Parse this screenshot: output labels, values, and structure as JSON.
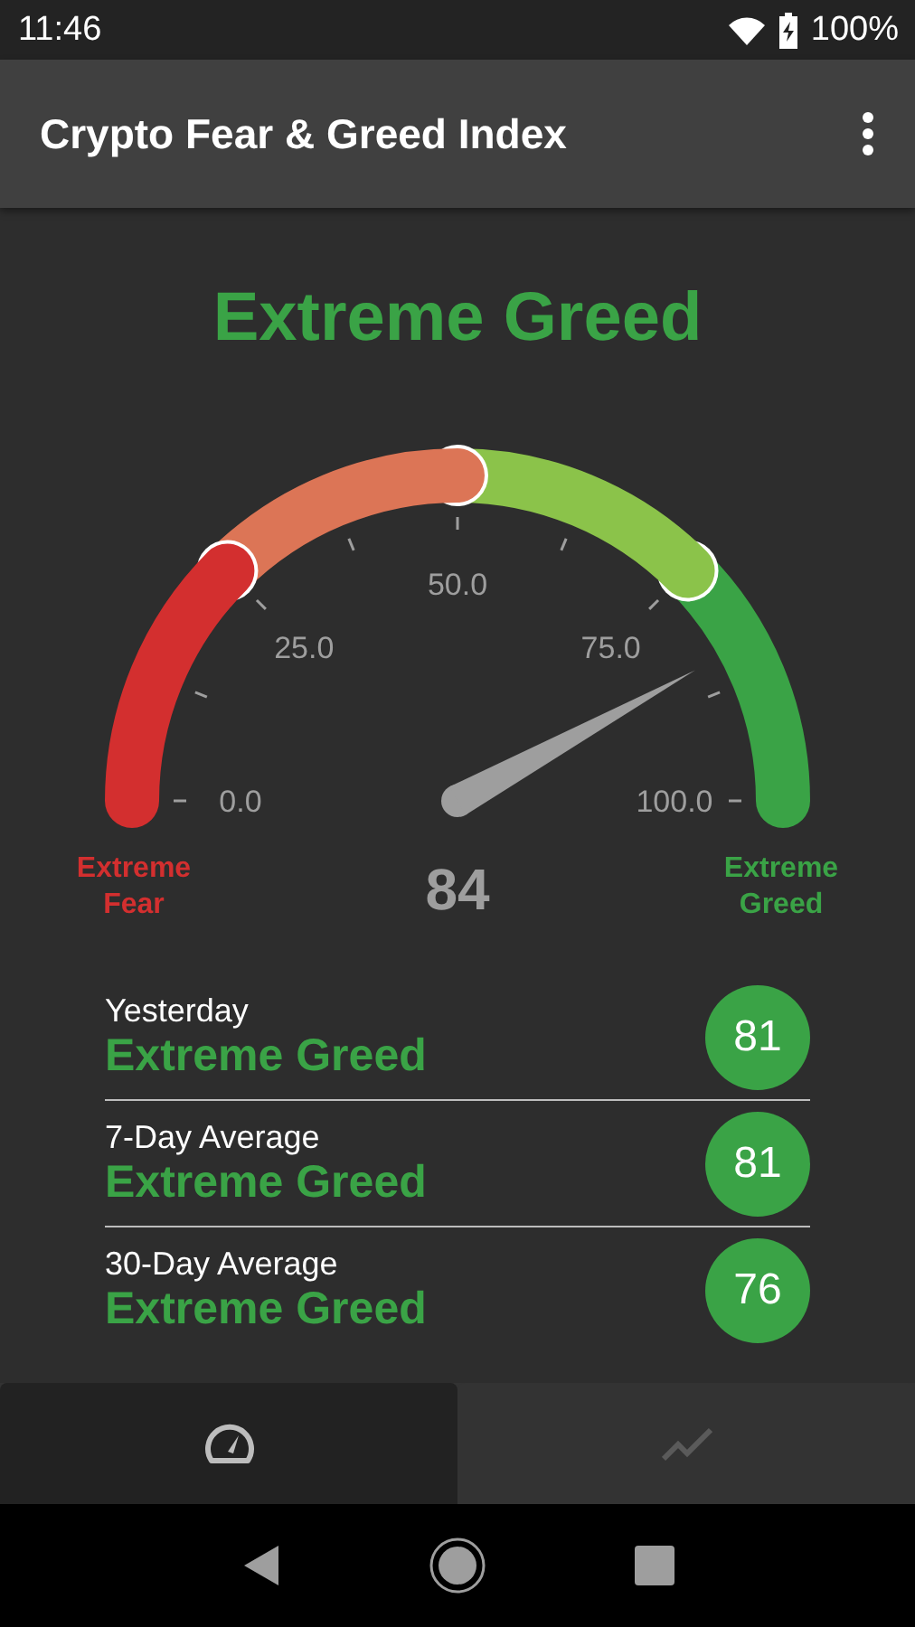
{
  "status_bar": {
    "time": "11:46",
    "battery": "100%"
  },
  "app_bar": {
    "title": "Crypto Fear & Greed Index"
  },
  "headline": "Extreme Greed",
  "gauge": {
    "value": "84",
    "min_label": "Extreme Fear",
    "max_label": "Extreme Greed",
    "segments": [
      {
        "color": "#d32f2f"
      },
      {
        "color": "#dc7556"
      },
      {
        "color": "#8bc34a"
      },
      {
        "color": "#3aa346"
      }
    ],
    "tick_labels": [
      "0.0",
      "25.0",
      "50.0",
      "75.0",
      "100.0"
    ]
  },
  "history": [
    {
      "period": "Yesterday",
      "classification": "Extreme Greed",
      "value": "81"
    },
    {
      "period": "7-Day Average",
      "classification": "Extreme Greed",
      "value": "81"
    },
    {
      "period": "30-Day Average",
      "classification": "Extreme Greed",
      "value": "76"
    }
  ],
  "bottom_nav": [
    {
      "kind": "gauge",
      "selected": true
    },
    {
      "kind": "chart",
      "selected": false
    }
  ]
}
